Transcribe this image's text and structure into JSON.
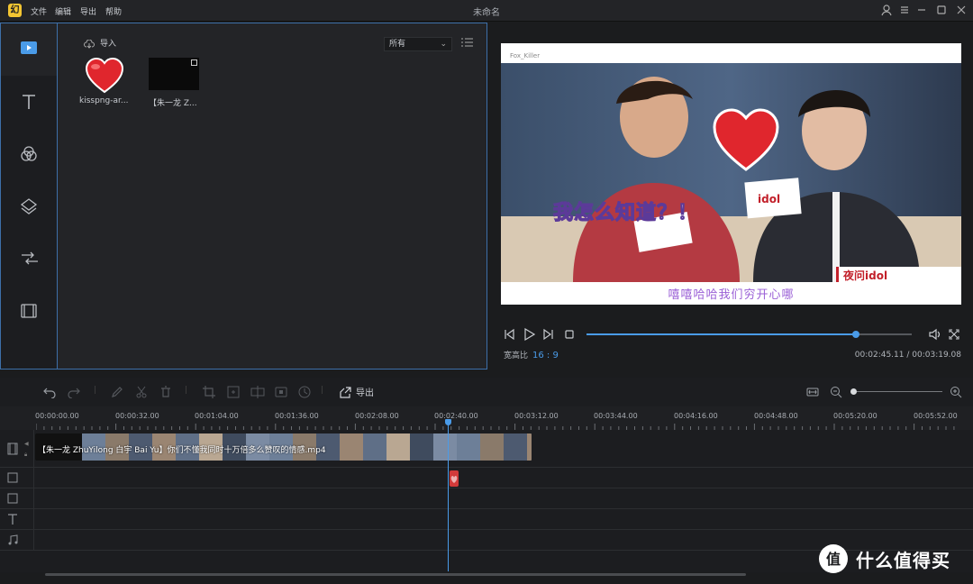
{
  "app": {
    "title": "未命名",
    "logo_glyph": "幻"
  },
  "menu": {
    "items": [
      "文件",
      "编辑",
      "导出",
      "帮助"
    ]
  },
  "media_panel": {
    "import_label": "导入",
    "filter_value": "所有",
    "items": [
      {
        "name": "kisspng-ar...",
        "kind": "image"
      },
      {
        "name": "【朱一龙 Z...",
        "kind": "video"
      }
    ]
  },
  "preview": {
    "corner_label": "Fox_Killer",
    "overlay_caption": "我怎么知道？！",
    "subtitle": "嘻嘻哈哈我们穷开心哪",
    "aspect_label": "宽高比",
    "aspect_value": "16 : 9",
    "current_time": "00:02:45.11",
    "total_time": "00:03:19.08",
    "progress_fraction": 0.829
  },
  "toolbar": {
    "export_label": "导出"
  },
  "timeline": {
    "ruler_labels": [
      "00:00:00.00",
      "00:00:32.00",
      "00:01:04.00",
      "00:01:36.00",
      "00:02:08.00",
      "00:02:40.00",
      "00:03:12.00",
      "00:03:44.00",
      "00:04:16.00",
      "00:04:48.00",
      "00:05:20.00",
      "00:05:52.00"
    ],
    "clip_title": "【朱一龙 ZhuYilong  白宇 Bai Yu】你们不懂我同时十万倍多么赞叹的情感.mp4"
  },
  "watermark": {
    "text": "什么值得买",
    "badge_glyph": "值"
  },
  "colors": {
    "accent": "#4a9be8",
    "panel_border": "#3d6fa8",
    "subtitle": "#9a5fd6"
  }
}
